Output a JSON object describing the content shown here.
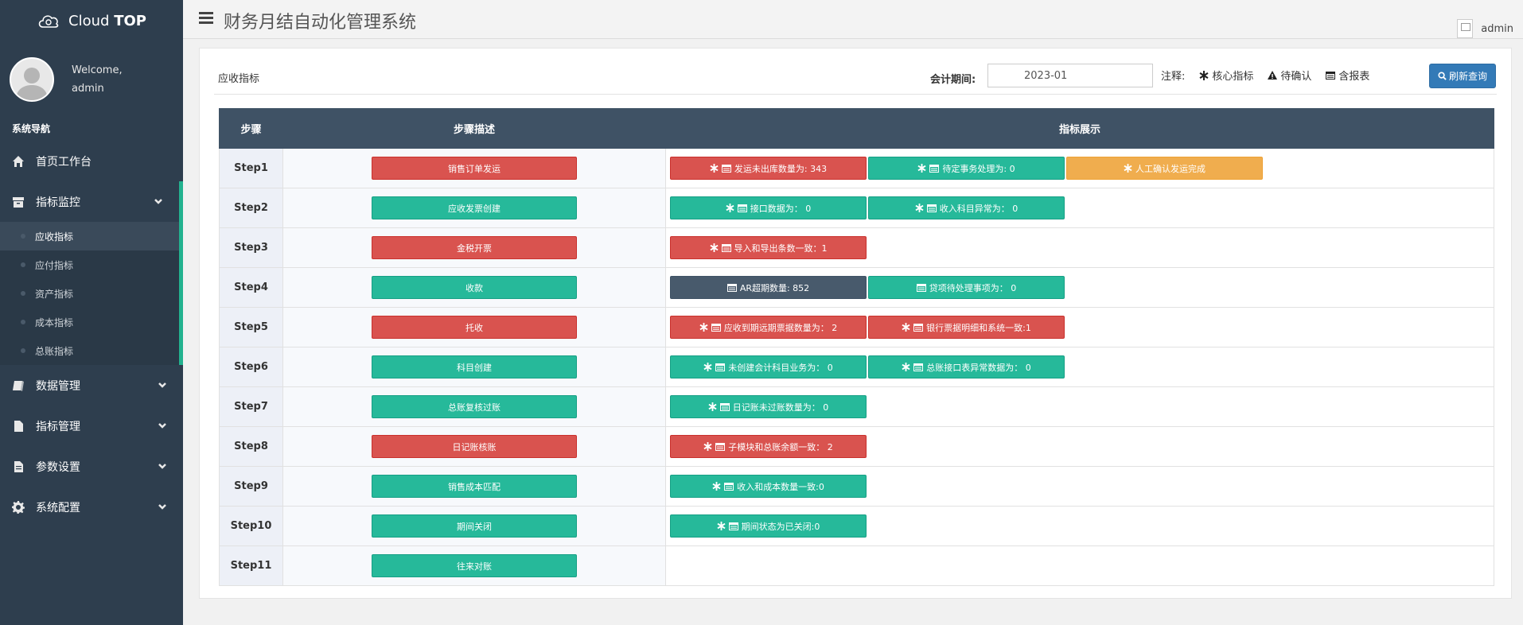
{
  "app": {
    "brand_left": "Cloud",
    "brand_right": "TOP",
    "welcome": "Welcome,",
    "username": "admin",
    "system_title": "财务月结自动化管理系统",
    "header_user": "admin"
  },
  "sidebar": {
    "heading": "系统导航",
    "items": [
      {
        "label": "首页工作台",
        "icon": "home-icon"
      },
      {
        "label": "指标监控",
        "icon": "archive-icon"
      },
      {
        "label": "数据管理",
        "icon": "book-icon"
      },
      {
        "label": "指标管理",
        "icon": "file-icon"
      },
      {
        "label": "参数设置",
        "icon": "file-text-icon"
      },
      {
        "label": "系统配置",
        "icon": "gear-icon"
      }
    ],
    "sub_items": [
      "应收指标",
      "应付指标",
      "资产指标",
      "成本指标",
      "总账指标"
    ],
    "active_sub": "应收指标"
  },
  "panel": {
    "title": "应收指标",
    "period_label": "会计期间:",
    "period_value": "2023-01",
    "legend_label": "注释:",
    "legend_core": "核心指标",
    "legend_pending": "待确认",
    "legend_report": "含报表",
    "refresh_label": "刷新查询"
  },
  "table": {
    "headers": [
      "步骤",
      "步骤描述",
      "指标展示"
    ],
    "rows": [
      {
        "step": "Step1",
        "desc": "销售订单发运",
        "desc_color": "red",
        "indicators": [
          {
            "text": "发运未出库数量为: 343",
            "color": "red",
            "star": true,
            "table": true
          },
          {
            "text": "待定事务处理为: 0",
            "color": "green",
            "star": true,
            "table": true
          },
          {
            "text": "人工确认发运完成",
            "color": "orange",
            "star": true,
            "table": false
          }
        ]
      },
      {
        "step": "Step2",
        "desc": "应收发票创建",
        "desc_color": "green",
        "indicators": [
          {
            "text": "接口数据为： 0",
            "color": "green",
            "star": true,
            "table": true
          },
          {
            "text": "收入科目异常为： 0",
            "color": "green",
            "star": true,
            "table": true
          }
        ]
      },
      {
        "step": "Step3",
        "desc": "金税开票",
        "desc_color": "red",
        "indicators": [
          {
            "text": "导入和导出条数一致：1",
            "color": "red",
            "star": true,
            "table": true
          }
        ]
      },
      {
        "step": "Step4",
        "desc": "收款",
        "desc_color": "green",
        "indicators": [
          {
            "text": "AR超期数量: 852",
            "color": "dark",
            "star": false,
            "table": true
          },
          {
            "text": "贷项待处理事项为： 0",
            "color": "green",
            "star": false,
            "table": true
          }
        ]
      },
      {
        "step": "Step5",
        "desc": "托收",
        "desc_color": "red",
        "indicators": [
          {
            "text": "应收到期远期票据数量为： 2",
            "color": "red",
            "star": true,
            "table": true
          },
          {
            "text": "银行票据明细和系统一致:1",
            "color": "red",
            "star": true,
            "table": true
          }
        ]
      },
      {
        "step": "Step6",
        "desc": "科目创建",
        "desc_color": "green",
        "indicators": [
          {
            "text": "未创建会计科目业务为： 0",
            "color": "green",
            "star": true,
            "table": true
          },
          {
            "text": "总账接口表异常数据为： 0",
            "color": "green",
            "star": true,
            "table": true
          }
        ]
      },
      {
        "step": "Step7",
        "desc": "总账复核过账",
        "desc_color": "green",
        "indicators": [
          {
            "text": "日记账未过账数量为： 0",
            "color": "green",
            "star": true,
            "table": true
          }
        ]
      },
      {
        "step": "Step8",
        "desc": "日记账核账",
        "desc_color": "red",
        "indicators": [
          {
            "text": "子模块和总账余额一致： 2",
            "color": "red",
            "star": true,
            "table": true
          }
        ]
      },
      {
        "step": "Step9",
        "desc": "销售成本匹配",
        "desc_color": "green",
        "indicators": [
          {
            "text": "收入和成本数量一致:0",
            "color": "green",
            "star": true,
            "table": true
          }
        ]
      },
      {
        "step": "Step10",
        "desc": "期间关闭",
        "desc_color": "green",
        "indicators": [
          {
            "text": "期间状态为已关闭:0",
            "color": "green",
            "star": true,
            "table": true
          }
        ]
      },
      {
        "step": "Step11",
        "desc": "往来对账",
        "desc_color": "green",
        "indicators": []
      }
    ]
  }
}
